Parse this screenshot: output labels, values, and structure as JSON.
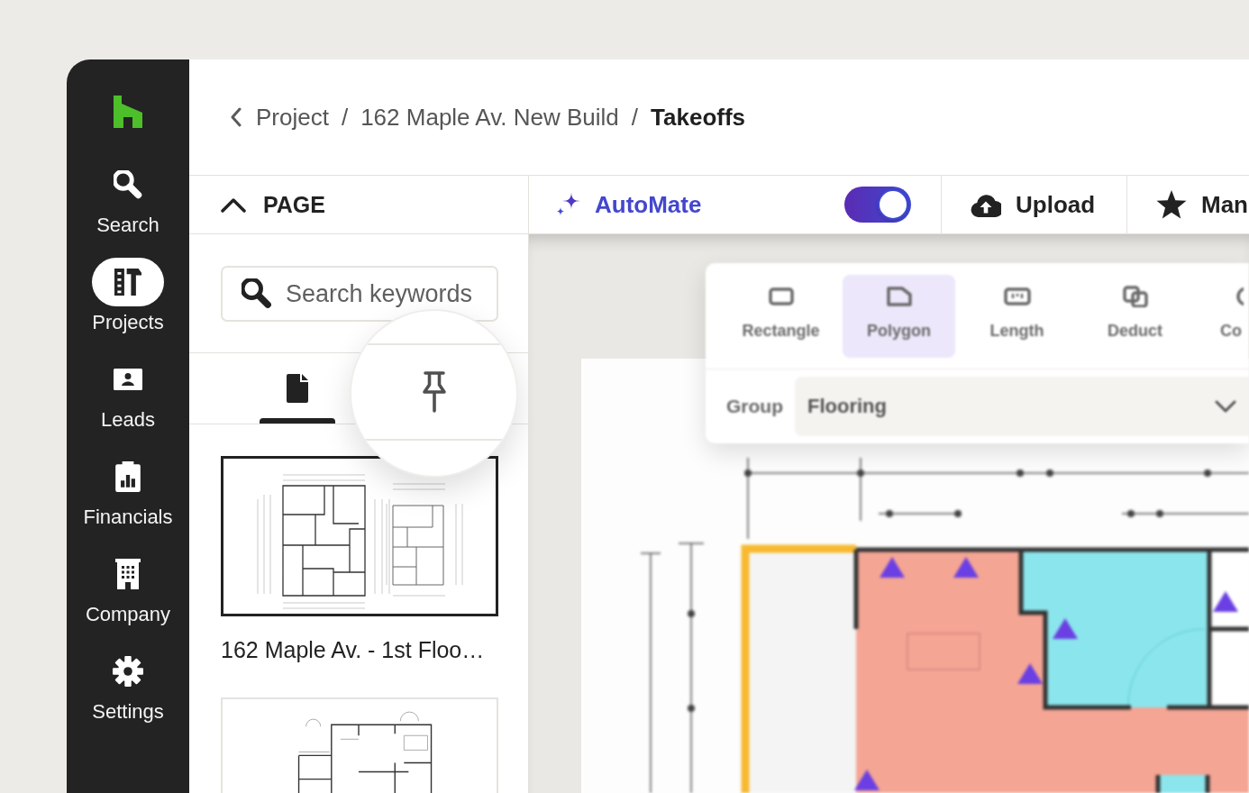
{
  "sidebar": {
    "items": [
      {
        "label": "Search",
        "selected": false
      },
      {
        "label": "Projects",
        "selected": true
      },
      {
        "label": "Leads",
        "selected": false
      },
      {
        "label": "Financials",
        "selected": false
      },
      {
        "label": "Company",
        "selected": false
      },
      {
        "label": "Settings",
        "selected": false
      }
    ]
  },
  "breadcrumb": {
    "items": [
      {
        "label": "Project",
        "current": false,
        "separator": "/"
      },
      {
        "label": "162 Maple Av. New Build",
        "current": false,
        "separator": "/"
      },
      {
        "label": "Takeoffs",
        "current": true
      }
    ]
  },
  "toolbar": {
    "page_section": {
      "label": "PAGE",
      "expanded": true
    },
    "automate": {
      "label": "AutoMate",
      "on": true
    },
    "buttons": [
      {
        "label": "Upload"
      },
      {
        "label": "Man"
      }
    ]
  },
  "page_panel": {
    "search": {
      "placeholder": "Search keywords"
    },
    "tabs": [
      {
        "selected": true,
        "magnified": false
      },
      {
        "selected": false,
        "magnified": true
      }
    ],
    "pages": [
      {
        "caption": "162 Maple Av. - 1st Floo…",
        "selected": true
      },
      {
        "selected": false
      }
    ]
  },
  "canvas": {
    "tools": [
      {
        "label": "Rectangle",
        "selected": false
      },
      {
        "label": "Polygon",
        "selected": true
      },
      {
        "label": "Length",
        "selected": false
      },
      {
        "label": "Deduct",
        "selected": false
      },
      {
        "label": "Co",
        "selected": false
      }
    ],
    "group": {
      "label": "Group",
      "value": "Flooring"
    }
  }
}
